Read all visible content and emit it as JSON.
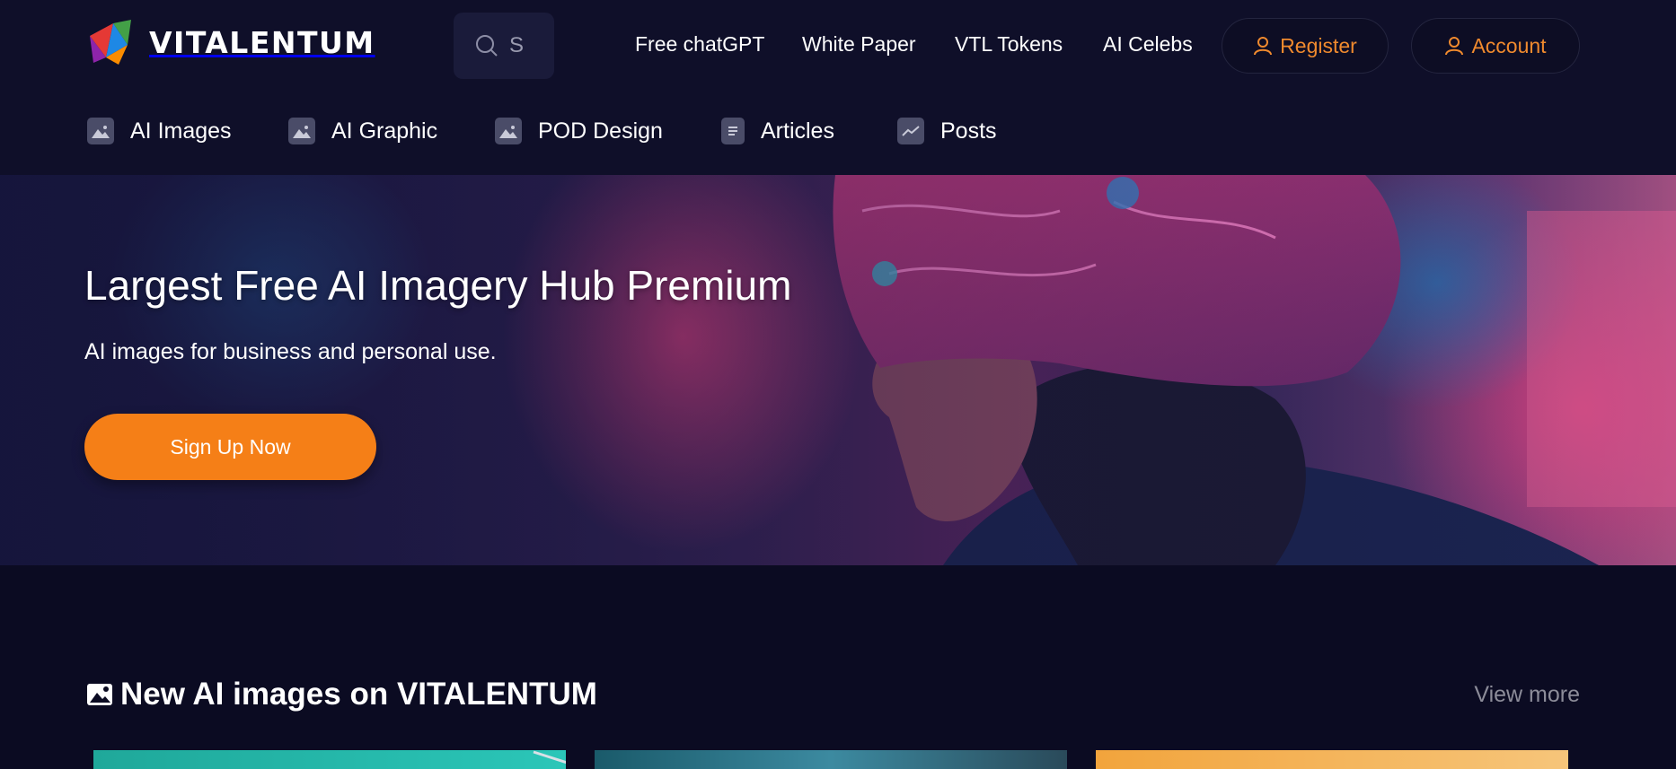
{
  "brand": {
    "name": "VITALENTUM"
  },
  "search": {
    "placeholder": "S"
  },
  "top_nav": {
    "items": [
      {
        "label": "Free chatGPT"
      },
      {
        "label": "White Paper"
      },
      {
        "label": "VTL Tokens"
      },
      {
        "label": "AI Celebs"
      }
    ],
    "register_label": "Register",
    "account_label": "Account"
  },
  "category_nav": {
    "items": [
      {
        "label": "AI Images",
        "icon": "image-icon"
      },
      {
        "label": "AI Graphic",
        "icon": "image-icon"
      },
      {
        "label": "POD Design",
        "icon": "image-icon"
      },
      {
        "label": "Articles",
        "icon": "document-icon"
      },
      {
        "label": "Posts",
        "icon": "chart-line-icon"
      }
    ]
  },
  "hero": {
    "title": "Largest Free AI Imagery Hub Premium",
    "subtitle": "AI images for business and personal use.",
    "cta_label": "Sign Up Now"
  },
  "section": {
    "title": "New AI images on VITALENTUM",
    "view_more_label": "View more"
  },
  "colors": {
    "background": "#0b0b22",
    "header": "#0f0f29",
    "accent": "#f57f17",
    "accent_text": "#f08a2e",
    "muted": "#8c8c99"
  }
}
